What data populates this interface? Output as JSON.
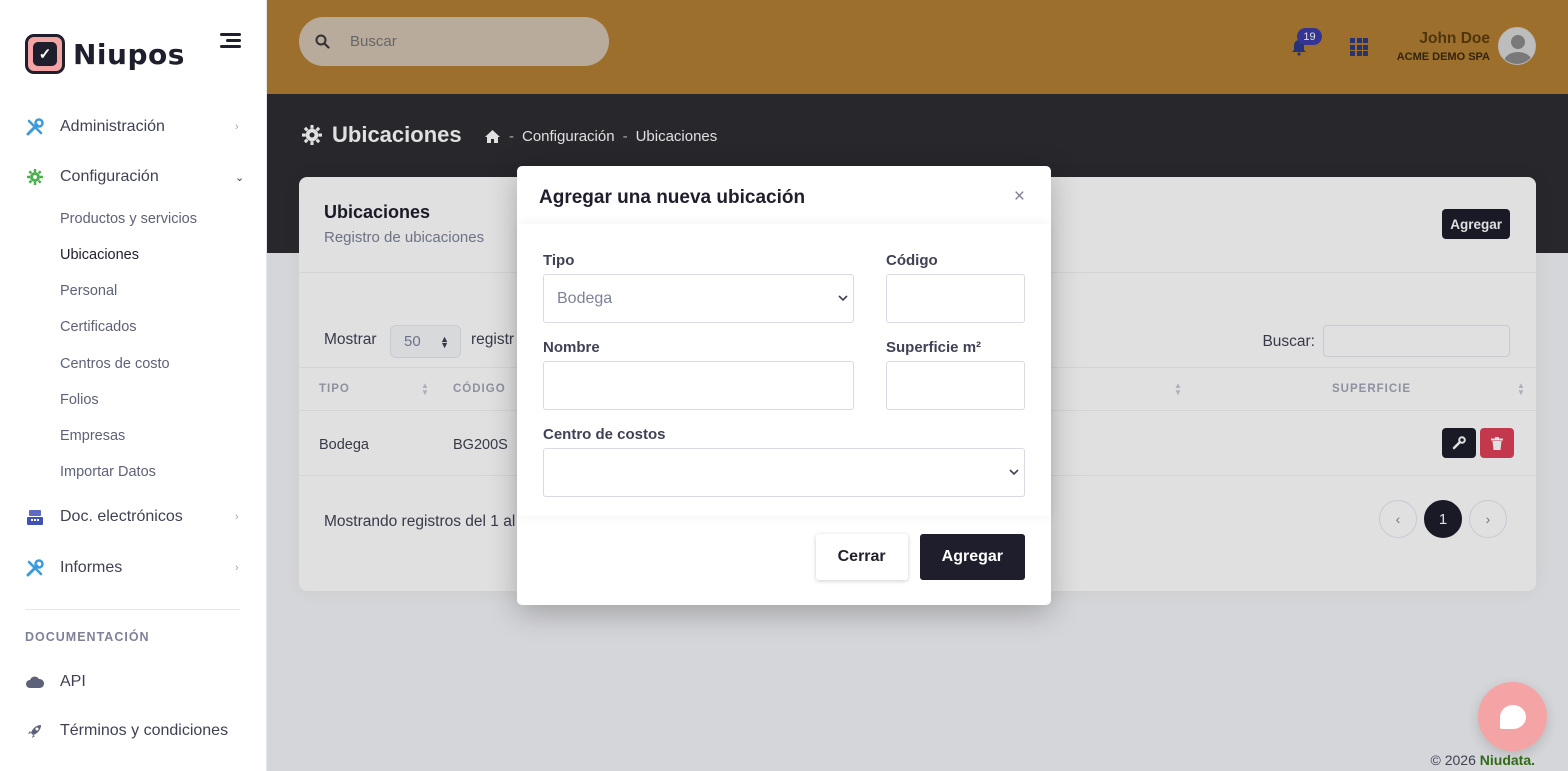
{
  "brand": {
    "name": "Niupos"
  },
  "sidebar": {
    "items": [
      {
        "label": "Administración"
      },
      {
        "label": "Configuración"
      },
      {
        "label": "Doc. electrónicos"
      },
      {
        "label": "Informes"
      }
    ],
    "subitems": [
      {
        "label": "Productos y servicios"
      },
      {
        "label": "Ubicaciones"
      },
      {
        "label": "Personal"
      },
      {
        "label": "Certificados"
      },
      {
        "label": "Centros de costo"
      },
      {
        "label": "Folios"
      },
      {
        "label": "Empresas"
      },
      {
        "label": "Importar Datos"
      }
    ],
    "doc_heading": "DOCUMENTACIÓN",
    "doc_items": [
      {
        "label": "API"
      },
      {
        "label": "Términos y condiciones"
      }
    ]
  },
  "header": {
    "search_placeholder": "Buscar",
    "notifications": "19",
    "user_name": "John Doe",
    "user_company": "ACME DEMO SPA"
  },
  "page": {
    "title": "Ubicaciones",
    "breadcrumb": [
      "-",
      "Configuración",
      "-",
      "Ubicaciones"
    ]
  },
  "card": {
    "title": "Ubicaciones",
    "subtitle": "Registro de ubicaciones",
    "add_label": "Agregar",
    "show_label": "Mostrar",
    "show_value": "50",
    "show_after": "registr",
    "search_label": "Buscar:",
    "columns": [
      "TIPO",
      "CÓDIGO",
      "SUPERFICIE"
    ],
    "rows": [
      {
        "tipo": "Bodega",
        "codigo": "BG200S"
      }
    ],
    "showing": "Mostrando registros del 1 al",
    "page": "1"
  },
  "modal": {
    "title": "Agregar una nueva ubicación",
    "close": "×",
    "tipo_label": "Tipo",
    "tipo_value": "Bodega",
    "codigo_label": "Código",
    "nombre_label": "Nombre",
    "superficie_label": "Superficie m²",
    "centro_label": "Centro de costos",
    "cancel_label": "Cerrar",
    "submit_label": "Agregar"
  },
  "footer": {
    "copyright": "© 2026",
    "brand": "Niudata."
  }
}
